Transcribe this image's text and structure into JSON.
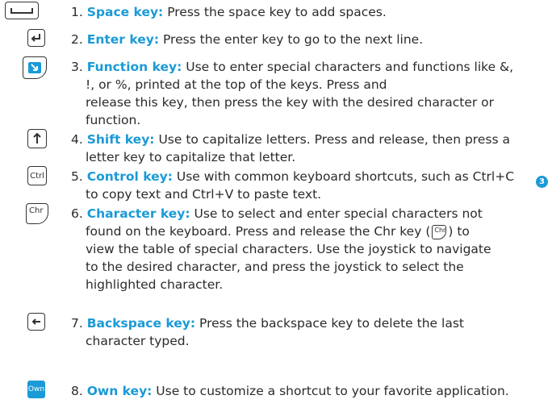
{
  "items": [
    {
      "num": "1.",
      "name": "Space key:",
      "text": " Press the space key to add spaces.",
      "icon": "space-key-icon"
    },
    {
      "num": "2.",
      "name": "Enter key:",
      "text": " Press the enter key to go to the next line.",
      "icon": "enter-key-icon"
    },
    {
      "num": "3.",
      "name": "Function key:",
      "text": " Use to enter special characters and functions like &,",
      "text2": "!, or %, printed at the top of the keys. Press and",
      "text3": "release this key, then press the key with the desired character or",
      "text4": "function.",
      "icon": "function-key-icon"
    },
    {
      "num": "4.",
      "name": "Shift key:",
      "text": " Use to capitalize letters. Press and release, then press a",
      "text2": "letter key to capitalize that letter.",
      "icon": "shift-key-icon"
    },
    {
      "num": "5.",
      "name": "Control key:",
      "text": " Use with common keyboard shortcuts, such as Ctrl+C",
      "text2": "to copy text and Ctrl+V to paste text.",
      "icon": "control-key-icon",
      "icon_label": "Ctrl"
    },
    {
      "num": "6.",
      "name": "Character key:",
      "text": " Use to select and enter special characters not",
      "text2a": "found on the keyboard. Press and release the Chr key (",
      "text2b": ") to",
      "text3": "view the table of special characters. Use the joystick to navigate",
      "text4": "to the desired character, and press the joystick to select the",
      "text5": "highlighted character.",
      "icon": "character-key-icon",
      "icon_label": "Chr"
    },
    {
      "num": "7.",
      "name": "Backspace key:",
      "text": " Press the backspace key to delete the last",
      "text2": "character typed.",
      "icon": "backspace-key-icon"
    },
    {
      "num": "8.",
      "name": "Own key:",
      "text": " Use to customize a shortcut to your favorite application.",
      "icon": "own-key-icon",
      "icon_label": "Own"
    }
  ],
  "badge": "3",
  "colors": {
    "accent": "#1a9ad6",
    "text": "#2b2b2b"
  }
}
